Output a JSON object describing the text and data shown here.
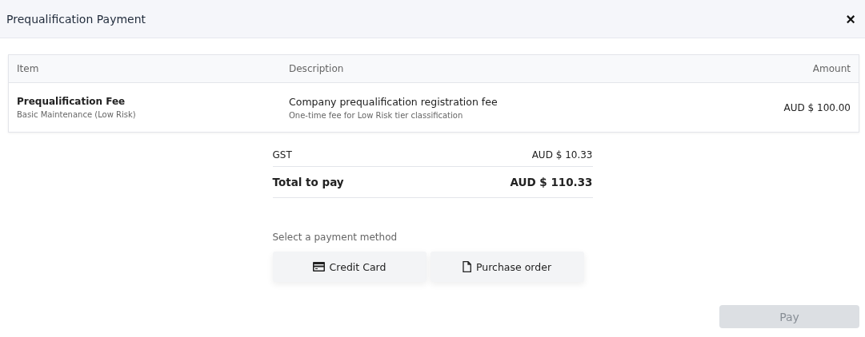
{
  "window": {
    "title": "Prequalification Payment",
    "close": "×"
  },
  "table": {
    "columns": [
      "Item",
      "Description",
      "Amount"
    ],
    "rows": [
      {
        "item": "Prequalification Fee",
        "item_detail": "Basic Maintenance (Low Risk)",
        "description": "Company prequalification registration fee",
        "description_detail": "One-time fee for Low Risk tier classification",
        "amount": "AUD $ 100.00"
      }
    ]
  },
  "summary": [
    {
      "kind": "tax",
      "label": "GST",
      "value": "AUD $ 10.33"
    },
    {
      "kind": "total",
      "label": "Total to pay",
      "value": "AUD $ 110.33"
    }
  ],
  "payment": {
    "label": "Select a payment method",
    "methods": [
      {
        "kind": "card",
        "label": "Credit Card",
        "selected": false
      },
      {
        "kind": "document",
        "label": "Purchase order",
        "selected": false
      }
    ]
  },
  "pay_button": {
    "label": "Pay",
    "disabled": true
  }
}
